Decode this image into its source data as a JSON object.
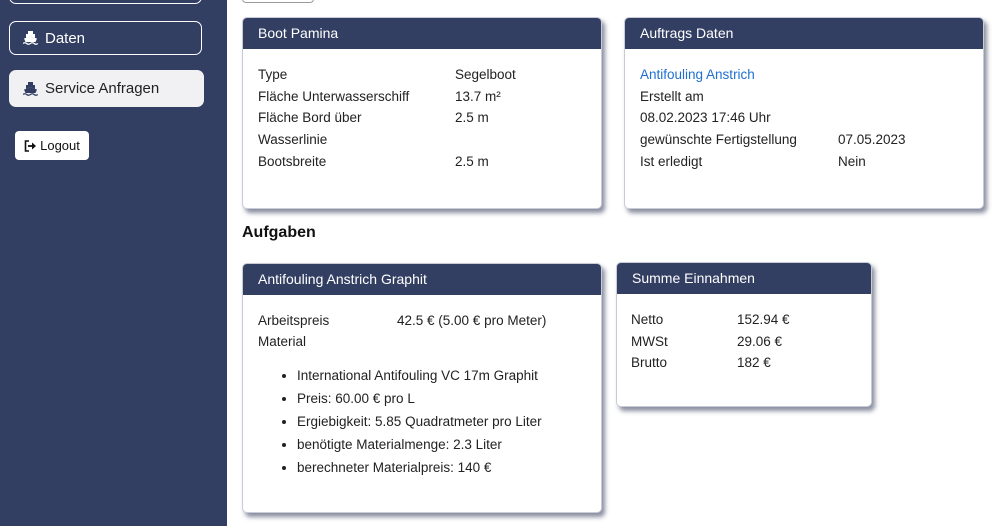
{
  "sidebar": {
    "items": [
      {
        "label": "Daten",
        "icon": "ship-icon"
      },
      {
        "label": "Service Anfragen",
        "icon": "ship-icon"
      }
    ],
    "logout_label": "Logout"
  },
  "boat": {
    "title": "Boot Pamina",
    "rows": [
      {
        "label": "Type",
        "value": "Segelboot"
      },
      {
        "label": "Fläche Unterwasserschiff",
        "value": "13.7 m²"
      },
      {
        "label": "Fläche Bord über",
        "value": "2.5 m"
      },
      {
        "label": "Wasserlinie",
        "value": ""
      },
      {
        "label": "Bootsbreite",
        "value": "2.5 m"
      }
    ]
  },
  "order": {
    "title": "Auftrags Daten",
    "link": "Antifouling Anstrich",
    "created_label": "Erstellt am",
    "created_value": "08.02.2023 17:46 Uhr",
    "due_label": "gewünschte Fertigstellung",
    "due_value": "07.05.2023",
    "done_label": "Ist erledigt",
    "done_value": "Nein"
  },
  "tasks_heading": "Aufgaben",
  "task": {
    "title": "Antifouling Anstrich Graphit",
    "work_label": "Arbeitspreis",
    "work_value": "42.5 € (5.00 € pro Meter)",
    "material_label": "Material",
    "materials": [
      "International Antifouling VC 17m Graphit",
      "Preis: 60.00 € pro L",
      "Ergiebigkeit: 5.85 Quadratmeter pro Liter",
      "benötigte Materialmenge: 2.3 Liter",
      "berechneter Materialpreis: 140 €"
    ]
  },
  "sum": {
    "title": "Summe Einnahmen",
    "rows": [
      {
        "label": "Netto",
        "value": "152.94 €"
      },
      {
        "label": "MWSt",
        "value": "29.06 €"
      },
      {
        "label": "Brutto",
        "value": "182 €"
      }
    ]
  }
}
